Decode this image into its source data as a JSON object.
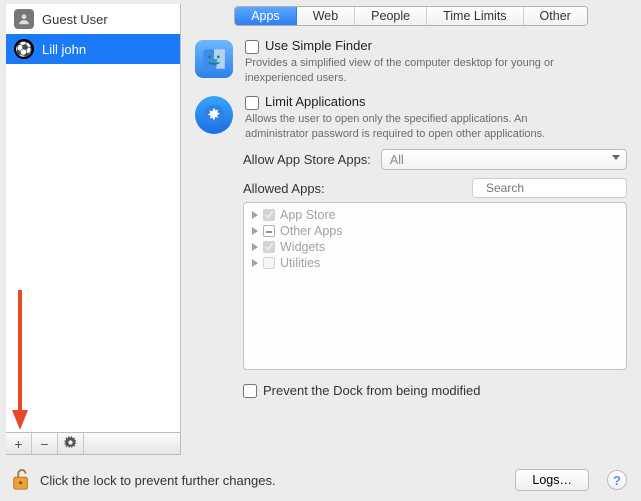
{
  "sidebar": {
    "users": [
      {
        "name": "Guest User",
        "avatar": "silhouette",
        "selected": false
      },
      {
        "name": "Lill john",
        "avatar": "soccer",
        "selected": true
      }
    ],
    "buttons": {
      "add": "+",
      "remove": "−",
      "settings": "gear"
    }
  },
  "tabs": [
    {
      "label": "Apps",
      "active": true
    },
    {
      "label": "Web",
      "active": false
    },
    {
      "label": "People",
      "active": false
    },
    {
      "label": "Time Limits",
      "active": false
    },
    {
      "label": "Other",
      "active": false
    }
  ],
  "options": {
    "simple_finder": {
      "label": "Use Simple Finder",
      "checked": false,
      "desc": "Provides a simplified view of the computer desktop for young or inexperienced users."
    },
    "limit_apps": {
      "label": "Limit Applications",
      "checked": false,
      "desc": "Allows the user to open only the specified applications. An administrator password is required to open other applications."
    },
    "allow_store": {
      "label": "Allow App Store Apps:",
      "value": "All"
    },
    "allowed_apps_label": "Allowed Apps:",
    "search_placeholder": "Search",
    "app_tree": [
      {
        "name": "App Store",
        "state": "checked"
      },
      {
        "name": "Other Apps",
        "state": "mixed"
      },
      {
        "name": "Widgets",
        "state": "checked"
      },
      {
        "name": "Utilities",
        "state": "unchecked"
      }
    ],
    "prevent_dock": {
      "label": "Prevent the Dock from being modified",
      "checked": false
    }
  },
  "footer": {
    "lock_text": "Click the lock to prevent further changes.",
    "logs_label": "Logs…"
  }
}
